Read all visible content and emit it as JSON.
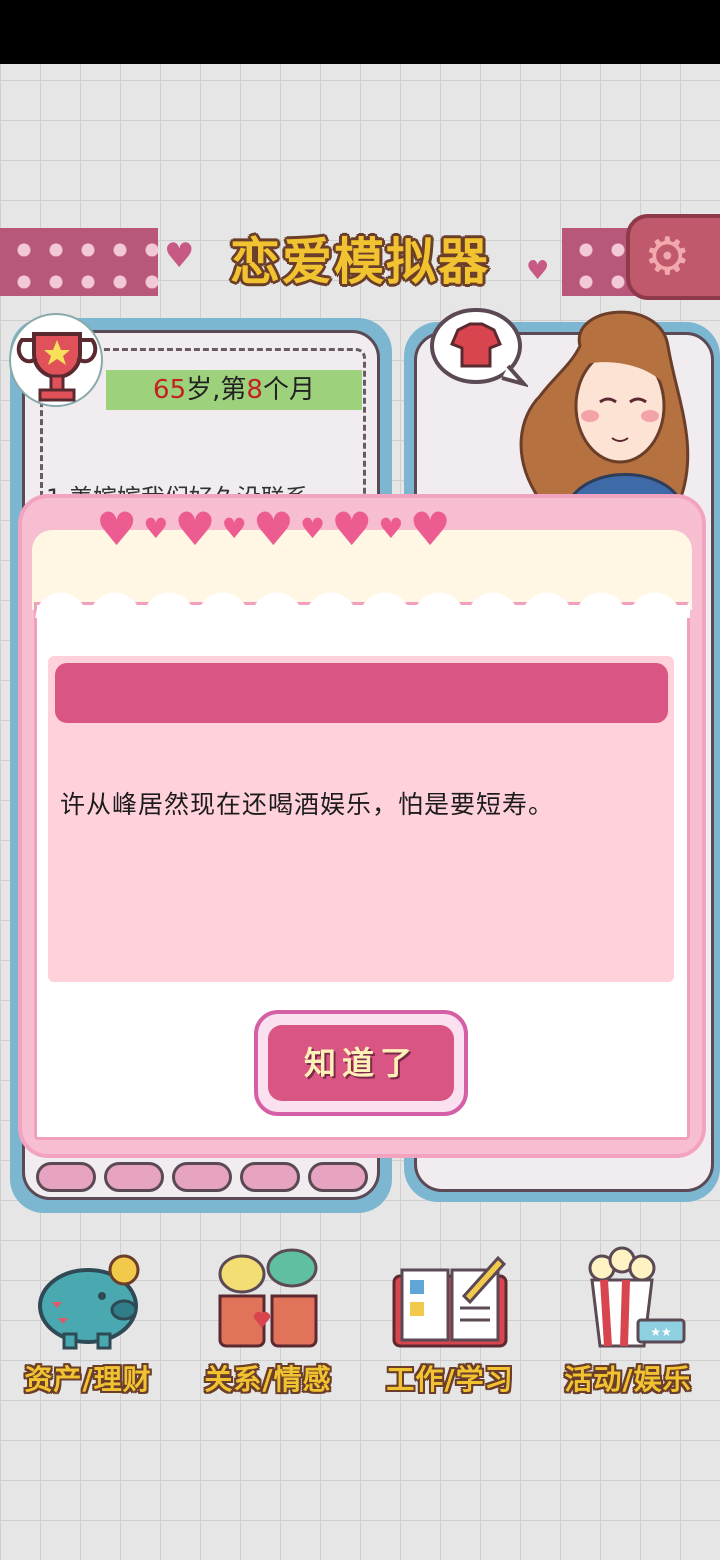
{
  "header": {
    "title": "恋爱模拟器",
    "settings_icon": "gear-icon"
  },
  "status_card": {
    "age_value": "65",
    "age_unit": "岁,第",
    "month_value": "8",
    "month_unit": "个月",
    "event_line": "1.姜嫔嫔我们好久没联系"
  },
  "dialog": {
    "message": "许从峰居然现在还喝酒娱乐，怕是要短寿。",
    "confirm_label": "知道了"
  },
  "bottom_nav": {
    "items": [
      {
        "label": "资产/理财",
        "icon": "piggy-bank-icon"
      },
      {
        "label": "关系/情感",
        "icon": "coffee-cups-icon"
      },
      {
        "label": "工作/学习",
        "icon": "notebook-icon"
      },
      {
        "label": "活动/娱乐",
        "icon": "popcorn-icon"
      }
    ]
  },
  "colors": {
    "accent_pink": "#d95583",
    "title_yellow": "#f2c330",
    "card_blue": "#7cb6d1"
  }
}
